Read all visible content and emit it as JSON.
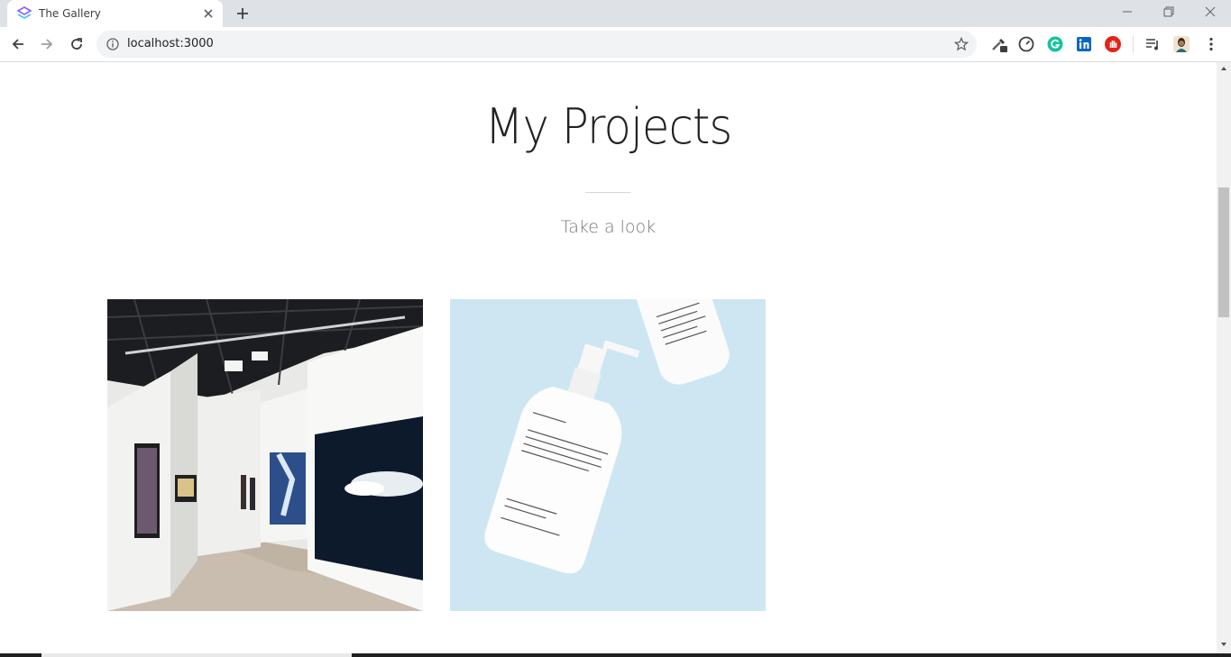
{
  "browser": {
    "tab": {
      "title": "The Gallery",
      "favicon": "stack-logo-icon"
    },
    "new_tab_icon": "plus-icon",
    "window_controls": [
      "minimize-icon",
      "restore-icon",
      "close-icon"
    ],
    "nav": [
      "back-arrow-icon",
      "forward-arrow-icon",
      "reload-icon"
    ],
    "address_bar": {
      "url": "localhost:3000",
      "info_icon": "info-icon",
      "bookmark_icon": "star-icon"
    },
    "extensions": [
      "eyedropper-extension-icon",
      "speedometer-extension-icon",
      "grammarly-extension-icon",
      "linkedin-extension-icon",
      "hand-stop-extension-icon",
      "media-queue-icon",
      "profile-avatar",
      "kebab-menu-icon"
    ]
  },
  "page": {
    "title": "My Projects",
    "subtitle": "Take a look",
    "projects": [
      {
        "image": "art-gallery-photo"
      },
      {
        "image": "shampoo-bottles-photo"
      }
    ]
  },
  "colors": {
    "tabstrip": "#dee1e6",
    "omnibox": "#f1f3f4",
    "title_text": "#222222",
    "subtitle_text": "#777777",
    "card2_background": "#cde6f2"
  }
}
